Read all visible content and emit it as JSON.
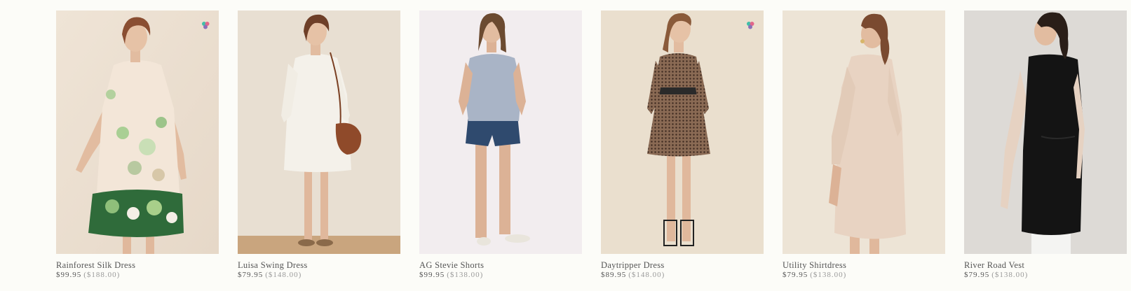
{
  "products": [
    {
      "name": "Rainforest Silk Dress",
      "sale_price": "$99.95",
      "original_price": "($188.00)",
      "has_swatch": true
    },
    {
      "name": "Luisa Swing Dress",
      "sale_price": "$79.95",
      "original_price": "($148.00)",
      "has_swatch": false
    },
    {
      "name": "AG Stevie Shorts",
      "sale_price": "$99.95",
      "original_price": "($138.00)",
      "has_swatch": false
    },
    {
      "name": "Daytripper Dress",
      "sale_price": "$89.95",
      "original_price": "($148.00)",
      "has_swatch": true
    },
    {
      "name": "Utility Shirtdress",
      "sale_price": "$79.95",
      "original_price": "($138.00)",
      "has_swatch": false
    },
    {
      "name": "River Road Vest",
      "sale_price": "$79.95",
      "original_price": "($138.00)",
      "has_swatch": false
    }
  ],
  "colors": {
    "background": "#fcfcf8",
    "name_text": "#555555",
    "original_price_text": "#9a9a9a",
    "swatch_teal": "#3fbfa8",
    "swatch_pink": "#e2668a",
    "swatch_purple": "#8a6fb8"
  }
}
